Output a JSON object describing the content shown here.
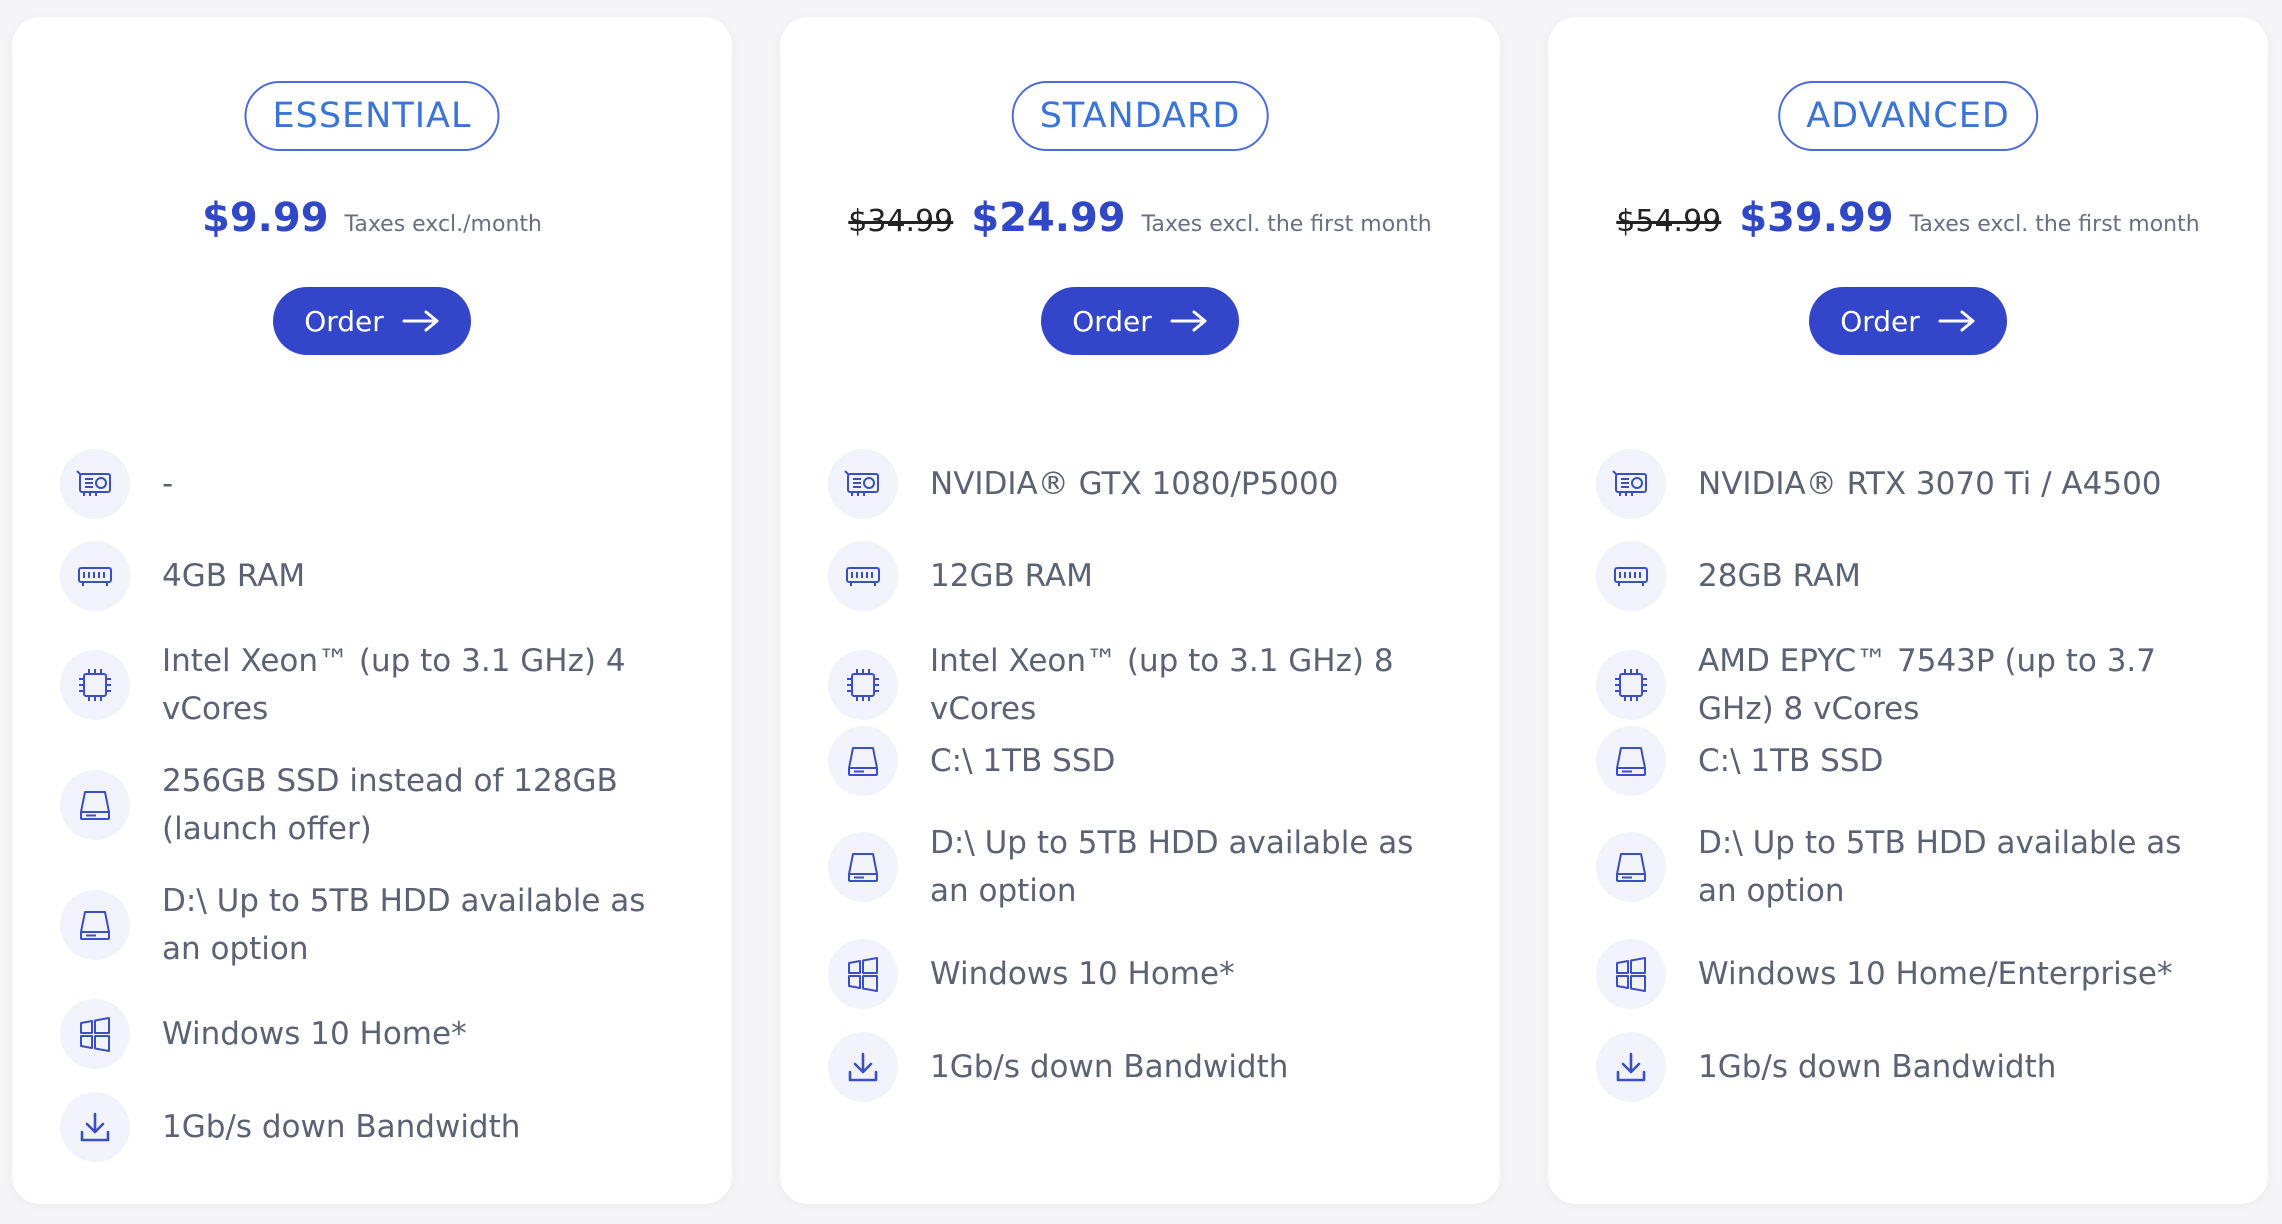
{
  "plans": [
    {
      "name": "ESSENTIAL",
      "old_price": "",
      "price": "$9.99",
      "price_note": "Taxes excl./month",
      "order_label": "Order",
      "features": [
        {
          "icon": "gpu-icon",
          "text": "-"
        },
        {
          "icon": "ram-icon",
          "text": "4GB RAM"
        },
        {
          "icon": "cpu-icon",
          "text": "Intel Xeon™ (up to 3.1 GHz) 4 vCores"
        },
        {
          "icon": "drive-icon",
          "text": "256GB SSD instead of 128GB (launch offer)"
        },
        {
          "icon": "drive-icon",
          "text": "D:\\ Up to 5TB HDD available as an option"
        },
        {
          "icon": "windows-icon",
          "text": "Windows 10 Home*"
        },
        {
          "icon": "download-icon",
          "text": "1Gb/s down Bandwidth"
        }
      ]
    },
    {
      "name": "STANDARD",
      "old_price": "$34.99",
      "price": "$24.99",
      "price_note": "Taxes excl. the first month",
      "order_label": "Order",
      "features": [
        {
          "icon": "gpu-icon",
          "text": "NVIDIA® GTX 1080/P5000"
        },
        {
          "icon": "ram-icon",
          "text": "12GB RAM"
        },
        {
          "icon": "cpu-icon",
          "text": "Intel Xeon™ (up to 3.1 GHz) 8 vCores"
        },
        {
          "icon": "drive-icon",
          "text": "C:\\ 1TB SSD"
        },
        {
          "icon": "drive-icon",
          "text": "D:\\ Up to 5TB HDD available as an option"
        },
        {
          "icon": "windows-icon",
          "text": "Windows 10 Home*"
        },
        {
          "icon": "download-icon",
          "text": "1Gb/s down Bandwidth"
        }
      ]
    },
    {
      "name": "ADVANCED",
      "old_price": "$54.99",
      "price": "$39.99",
      "price_note": "Taxes excl. the first month",
      "order_label": "Order",
      "features": [
        {
          "icon": "gpu-icon",
          "text": "NVIDIA® RTX 3070 Ti / A4500"
        },
        {
          "icon": "ram-icon",
          "text": "28GB RAM"
        },
        {
          "icon": "cpu-icon",
          "text": "AMD EPYC™ 7543P (up to 3.7 GHz) 8 vCores"
        },
        {
          "icon": "drive-icon",
          "text": "C:\\ 1TB SSD"
        },
        {
          "icon": "drive-icon",
          "text": "D:\\ Up to 5TB HDD available as an option"
        },
        {
          "icon": "windows-icon",
          "text": "Windows 10 Home/Enterprise*"
        },
        {
          "icon": "download-icon",
          "text": "1Gb/s down Bandwidth"
        }
      ]
    }
  ],
  "colors": {
    "accent": "#3346c9",
    "badge_text": "#3b74d8",
    "icon_bg": "#f2f3fa",
    "card_bg": "#ffffff",
    "page_bg": "#f4f4f6"
  }
}
